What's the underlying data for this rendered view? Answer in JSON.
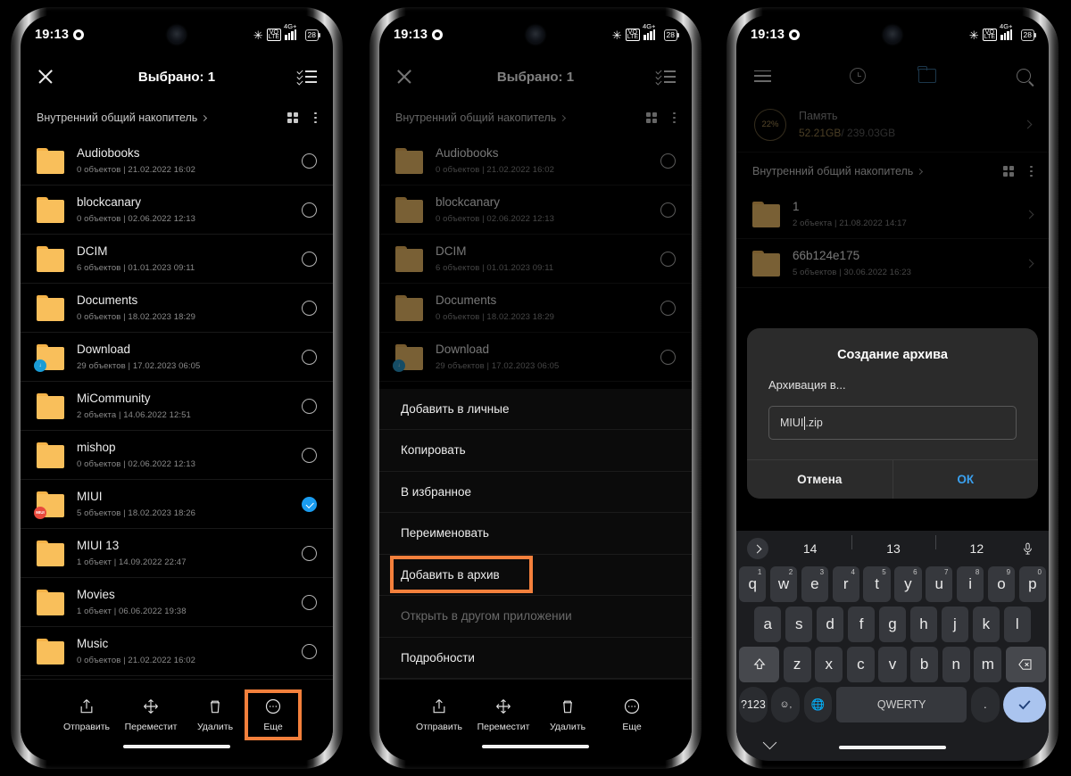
{
  "status_bar": {
    "time": "19:13",
    "battery": "28",
    "network": "4G+",
    "volte": "VO LTE"
  },
  "selection_header": {
    "title": "Выбрано: 1"
  },
  "breadcrumb": {
    "label": "Внутренний общий накопитель"
  },
  "files": [
    {
      "name": "Audiobooks",
      "meta": "0 объектов  |  21.02.2022 16:02",
      "checked": false,
      "badge": ""
    },
    {
      "name": "blockcanary",
      "meta": "0 объектов  |  02.06.2022 12:13",
      "checked": false,
      "badge": ""
    },
    {
      "name": "DCIM",
      "meta": "6 объектов  |  01.01.2023 09:11",
      "checked": false,
      "badge": ""
    },
    {
      "name": "Documents",
      "meta": "0 объектов  |  18.02.2023 18:29",
      "checked": false,
      "badge": ""
    },
    {
      "name": "Download",
      "meta": "29 объектов  |  17.02.2023 06:05",
      "checked": false,
      "badge": "download"
    },
    {
      "name": "MiCommunity",
      "meta": "2 объекта  |  14.06.2022 12:51",
      "checked": false,
      "badge": ""
    },
    {
      "name": "mishop",
      "meta": "0 объектов  |  02.06.2022 12:13",
      "checked": false,
      "badge": ""
    },
    {
      "name": "MIUI",
      "meta": "5 объектов  |  18.02.2023 18:26",
      "checked": true,
      "badge": "miui"
    },
    {
      "name": "MIUI 13",
      "meta": "1 объект  |  14.09.2022 22:47",
      "checked": false,
      "badge": ""
    },
    {
      "name": "Movies",
      "meta": "1 объект  |  06.06.2022 19:38",
      "checked": false,
      "badge": ""
    },
    {
      "name": "Music",
      "meta": "0 объектов  |  21.02.2022 16:02",
      "checked": false,
      "badge": ""
    }
  ],
  "toolbar": {
    "send": "Отправить",
    "move": "Переместит",
    "delete": "Удалить",
    "more": "Еще"
  },
  "context_menu": {
    "items": [
      {
        "label": "Добавить в личные",
        "disabled": false,
        "highlighted": false
      },
      {
        "label": "Копировать",
        "disabled": false,
        "highlighted": false
      },
      {
        "label": "В избранное",
        "disabled": false,
        "highlighted": false
      },
      {
        "label": "Переименовать",
        "disabled": false,
        "highlighted": false
      },
      {
        "label": "Добавить в архив",
        "disabled": false,
        "highlighted": true
      },
      {
        "label": "Открыть в другом приложении",
        "disabled": true,
        "highlighted": false
      },
      {
        "label": "Подробности",
        "disabled": false,
        "highlighted": false
      }
    ]
  },
  "phone3": {
    "storage": {
      "percent": "22%",
      "label": "Память",
      "used": "52.21GB",
      "total": "/ 239.03GB"
    },
    "breadcrumb": "Внутренний общий накопитель",
    "files": [
      {
        "name": "1",
        "meta": "2 объекта  |  21.08.2022 14:17"
      },
      {
        "name": "66b124e175",
        "meta": "5 объектов  |  30.06.2022 16:23"
      }
    ],
    "dialog": {
      "title": "Создание архива",
      "subtitle": "Архивация в...",
      "input_value_before_caret": "MIUI",
      "input_value_after_caret": ".zip",
      "cancel": "Отмена",
      "ok": "ОК"
    },
    "keyboard": {
      "suggestions": [
        "14",
        "13",
        "12"
      ],
      "row1": [
        {
          "k": "q",
          "sup": "1"
        },
        {
          "k": "w",
          "sup": "2"
        },
        {
          "k": "e",
          "sup": "3"
        },
        {
          "k": "r",
          "sup": "4"
        },
        {
          "k": "t",
          "sup": "5"
        },
        {
          "k": "y",
          "sup": "6"
        },
        {
          "k": "u",
          "sup": "7"
        },
        {
          "k": "i",
          "sup": "8"
        },
        {
          "k": "o",
          "sup": "9"
        },
        {
          "k": "p",
          "sup": "0"
        }
      ],
      "row2": [
        "a",
        "s",
        "d",
        "f",
        "g",
        "h",
        "j",
        "k",
        "l"
      ],
      "row3": [
        "z",
        "x",
        "c",
        "v",
        "b",
        "n",
        "m"
      ],
      "numeric_key": "?123",
      "space_label": "QWERTY",
      "period_key": ".",
      "emoji_key": "☺"
    }
  },
  "colors": {
    "accent_highlight": "#f4803c",
    "folder": "#f9bf5b",
    "checked_blue": "#1a9cf0",
    "link_blue": "#3aa0ef",
    "storage_gold": "#b08c4a"
  }
}
